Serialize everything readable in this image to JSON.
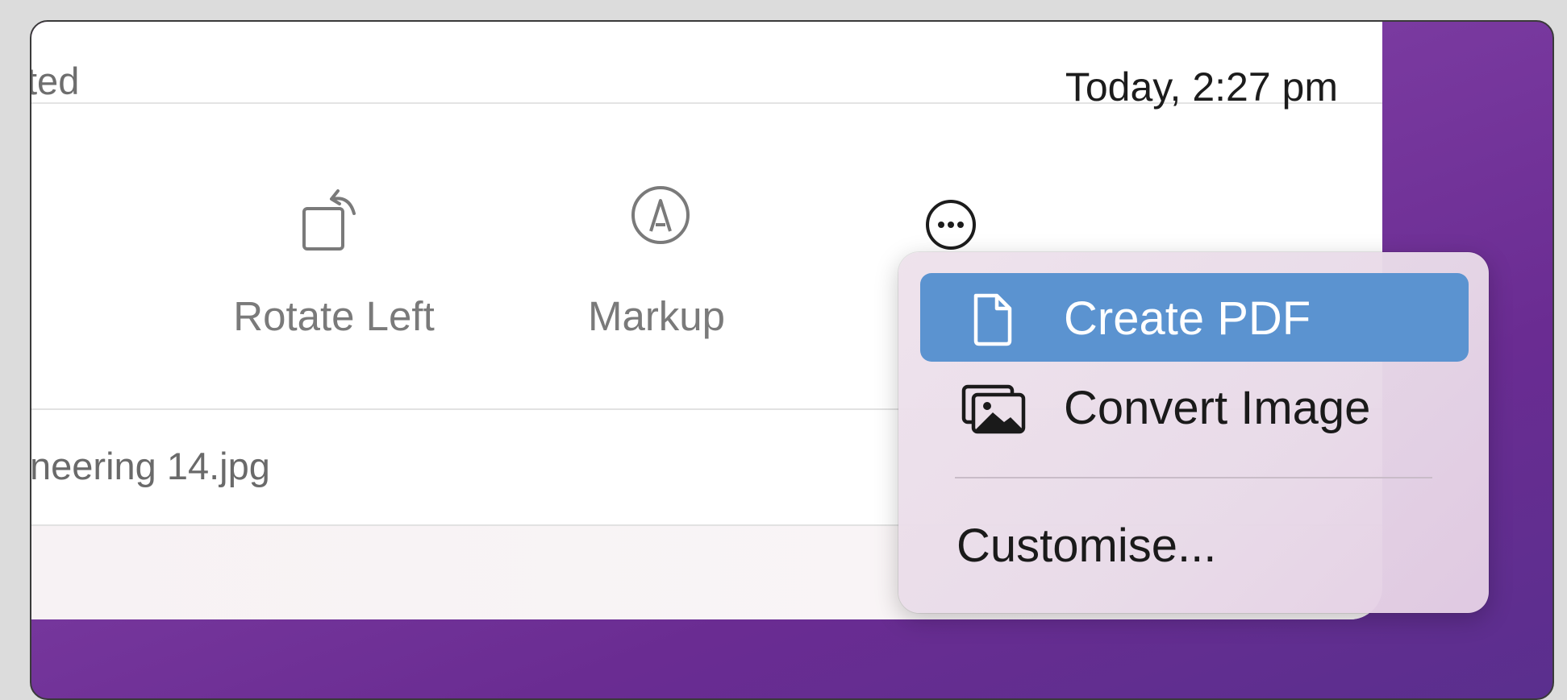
{
  "header": {
    "left_text": "ted",
    "right_text": "Today, 2:27 pm"
  },
  "toolbar": {
    "rotate_left_label": "Rotate Left",
    "markup_label": "Markup"
  },
  "file": {
    "name": "neering 14.jpg"
  },
  "menu": {
    "items": [
      {
        "label": "Create PDF",
        "icon": "document-icon",
        "highlighted": true
      },
      {
        "label": "Convert Image",
        "icon": "photos-icon",
        "highlighted": false
      }
    ],
    "customise_label": "Customise..."
  },
  "colors": {
    "menu_highlight": "#5b93d0",
    "desktop_purple": "#7a3aa0"
  }
}
